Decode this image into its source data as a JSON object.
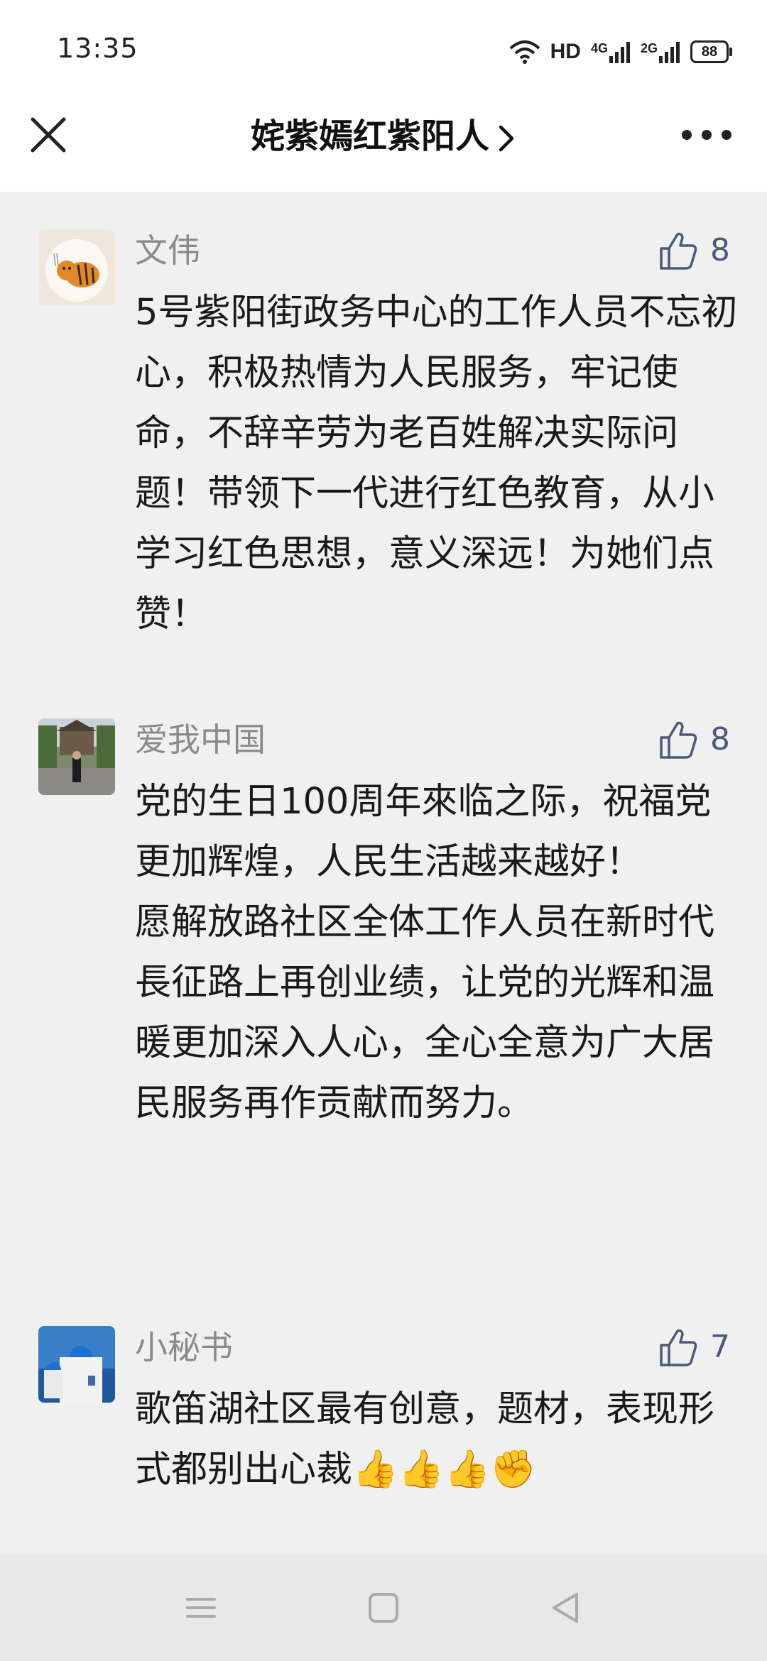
{
  "status_bar": {
    "time": "13:35",
    "network_hd": "HD",
    "network_4g": "4G",
    "network_2g": "2G",
    "battery": "88"
  },
  "header": {
    "title": "姹紫嫣红紫阳人",
    "close_icon": "close-icon",
    "more_icon": "more-icon"
  },
  "comments": [
    {
      "name": "文伟",
      "likes": "8",
      "avatar": "tiger-avatar",
      "text": "5号紫阳街政务中心的工作人员不忘初心，积极热情为人民服务，牢记使命，不辞辛劳为老百姓解决实际问题！带领下一代进行红色教育，从小学习红色思想，意义深远！为她们点赞！"
    },
    {
      "name": "爱我中国",
      "likes": "8",
      "avatar": "person-avatar",
      "text": "党的生日100周年來临之际，祝福党更加辉煌，人民生活越来越好！\n愿解放路社区全体工作人员在新时代長征路上再创业绩，让党的光辉和温暖更加深入人心，全心全意为广大居民服务再作贡献而努力。"
    },
    {
      "name": "小秘书",
      "likes": "7",
      "avatar": "santorini-avatar",
      "text": "歌笛湖社区最有创意，题材，表现形式都别出心裁",
      "emojis": "👍👍👍✊"
    }
  ],
  "colors": {
    "background": "#f0f0f0",
    "header_bg": "#ffffff",
    "name": "#8a8a8a",
    "like": "#4a5a7a"
  }
}
